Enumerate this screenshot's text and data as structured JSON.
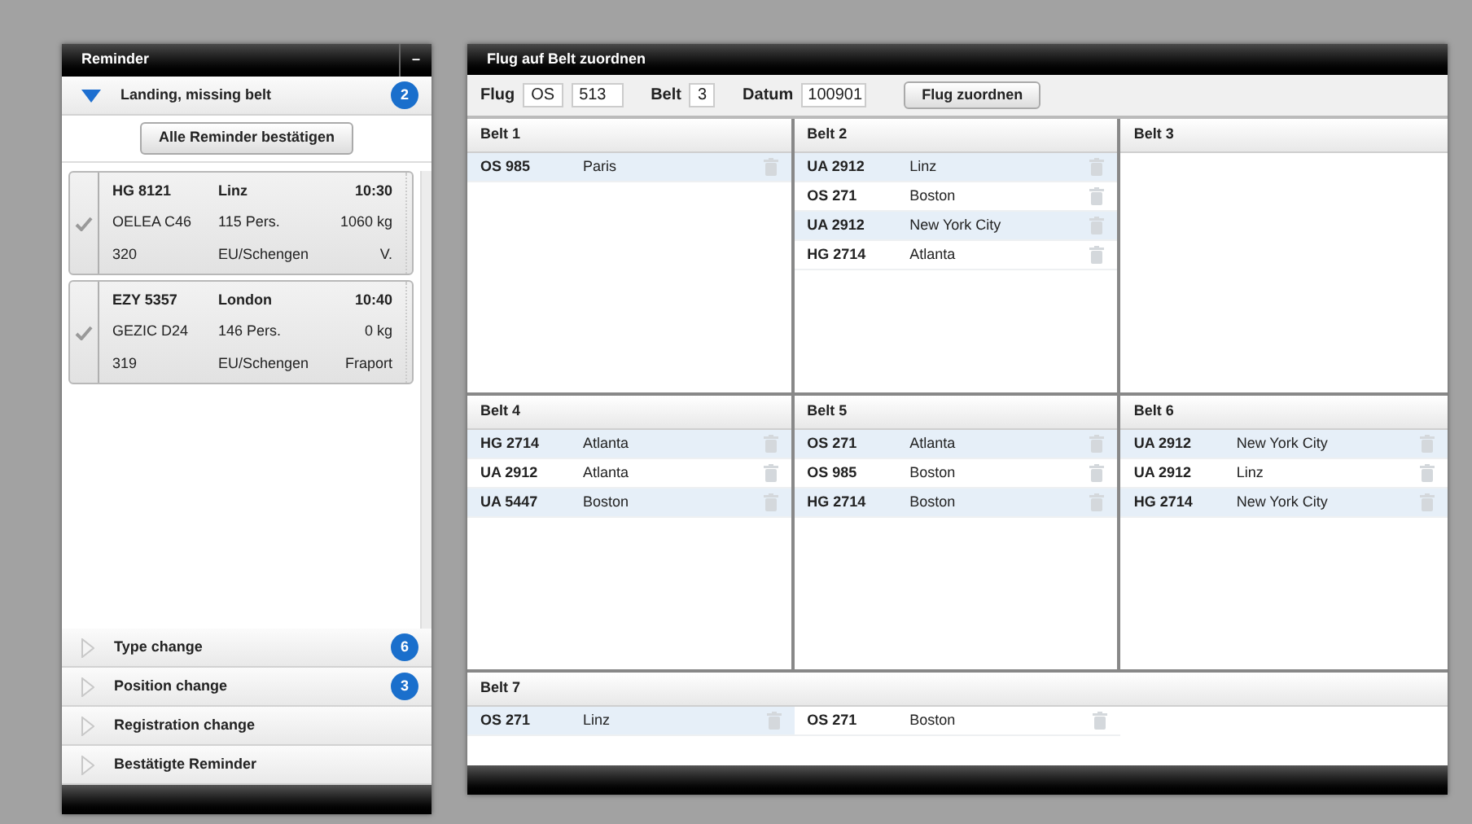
{
  "reminder": {
    "title": "Reminder",
    "collapse_button": "–",
    "sections": [
      {
        "label": "Landing, missing belt",
        "badge": "2",
        "expanded": true,
        "confirm_button": "Alle Reminder bestätigen",
        "cards": [
          {
            "checked": true,
            "lines": [
              [
                "HG 8121",
                "Linz",
                "10:30"
              ],
              [
                "OELEA C46",
                "115 Pers.",
                "1060 kg"
              ],
              [
                "320",
                "EU/Schengen",
                "V."
              ]
            ]
          },
          {
            "checked": true,
            "lines": [
              [
                "EZY 5357",
                "London",
                "10:40"
              ],
              [
                "GEZIC  D24",
                "146 Pers.",
                "0 kg"
              ],
              [
                "319",
                "EU/Schengen",
                "Fraport"
              ]
            ]
          }
        ]
      },
      {
        "label": "Type change",
        "badge": "6",
        "expanded": false
      },
      {
        "label": "Position change",
        "badge": "3",
        "expanded": false
      },
      {
        "label": "Registration change",
        "expanded": false
      },
      {
        "label": "Bestätigte Reminder",
        "expanded": false
      }
    ]
  },
  "assign": {
    "title": "Flug auf Belt zuordnen",
    "form": {
      "flug_label": "Flug",
      "airline": "OS",
      "number": "513",
      "belt_label": "Belt",
      "belt": "3",
      "datum_label": "Datum",
      "datum": "100901",
      "button": "Flug zuordnen"
    },
    "belts": [
      {
        "name": "Belt 1",
        "flights": [
          {
            "flight": "OS 985",
            "city": "Paris"
          }
        ]
      },
      {
        "name": "Belt 2",
        "flights": [
          {
            "flight": "UA 2912",
            "city": "Linz"
          },
          {
            "flight": "OS 271",
            "city": "Boston"
          },
          {
            "flight": "UA 2912",
            "city": "New York City"
          },
          {
            "flight": "HG 2714",
            "city": "Atlanta"
          }
        ]
      },
      {
        "name": "Belt 3"
      },
      {
        "name": "Belt 4",
        "flights": [
          {
            "flight": "HG 2714",
            "city": "Atlanta"
          },
          {
            "flight": "UA 2912",
            "city": "Atlanta"
          },
          {
            "flight": "UA 5447",
            "city": "Boston"
          }
        ]
      },
      {
        "name": "Belt 5",
        "flights": [
          {
            "flight": "OS 271",
            "city": "Atlanta"
          },
          {
            "flight": "OS 985",
            "city": "Boston"
          },
          {
            "flight": "HG 2714",
            "city": "Boston"
          }
        ]
      },
      {
        "name": "Belt 6",
        "flights": [
          {
            "flight": "UA 2912",
            "city": "New York City"
          },
          {
            "flight": "UA 2912",
            "city": "Linz"
          },
          {
            "flight": "HG 2714",
            "city": "New York City"
          }
        ]
      }
    ],
    "wide_belt": {
      "name": "Belt 7",
      "flights": [
        {
          "flight": "OS 271",
          "city": "Linz"
        },
        {
          "flight": "OS 271",
          "city": "Boston"
        }
      ]
    }
  }
}
